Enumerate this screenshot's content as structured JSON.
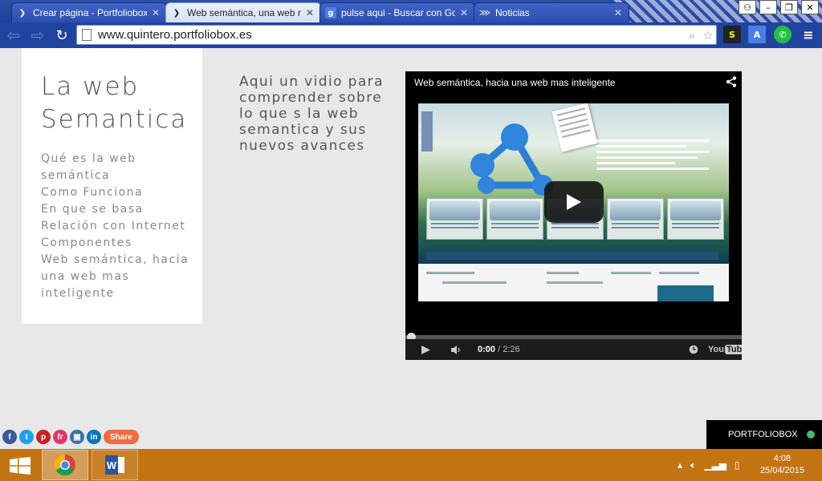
{
  "browser": {
    "tabs": [
      {
        "title": "Crear página - Portfoliobox",
        "favicon": "portfoliobox-icon",
        "active": false
      },
      {
        "title": "Web semántica, una web mas inteligente",
        "favicon": "portfoliobox-icon",
        "active": true
      },
      {
        "title": "pulse aqui - Buscar con Google",
        "favicon": "google-icon",
        "active": false
      },
      {
        "title": "Noticias",
        "favicon": "news-icon",
        "active": false
      }
    ],
    "url": "www.quintero.portfoliobox.es"
  },
  "page": {
    "site_title": "La web Semantica",
    "menu": [
      "Qué es la web semántica",
      "Como Funciona",
      "En que se basa",
      "Relación con Internet",
      "Componentes",
      "Web semántica, hacia una web mas inteligente"
    ],
    "intro_text": "Aqui un vidio para comprender sobre lo que s la web semantica y sus nuevos avances",
    "video": {
      "title": "Web semántica, hacia una web mas inteligente",
      "current_time": "0:00",
      "duration": "/ 2:26",
      "brand": "You",
      "brand_tube": "Tube",
      "progress": 0
    },
    "share_label": "Share",
    "portfoliobox_label": "PORTFOLIOBOX",
    "social": [
      {
        "name": "facebook-icon",
        "glyph": "f",
        "color": "#3b5998"
      },
      {
        "name": "twitter-icon",
        "glyph": "t",
        "color": "#1da1f2"
      },
      {
        "name": "pinterest-icon",
        "glyph": "p",
        "color": "#cb2027"
      },
      {
        "name": "friendfeed-icon",
        "glyph": "fr",
        "color": "#e0346c"
      },
      {
        "name": "instagram-icon",
        "glyph": "▣",
        "color": "#3f729b"
      },
      {
        "name": "linkedin-icon",
        "glyph": "in",
        "color": "#0077b5"
      }
    ]
  },
  "taskbar": {
    "time": "4:08",
    "date": "25/04/2015"
  },
  "colors": {
    "browser_frame": "#1f44a0",
    "taskbar": "#c37412",
    "share_pill": "#f36c3d",
    "status_dot": "#3dbb78"
  }
}
